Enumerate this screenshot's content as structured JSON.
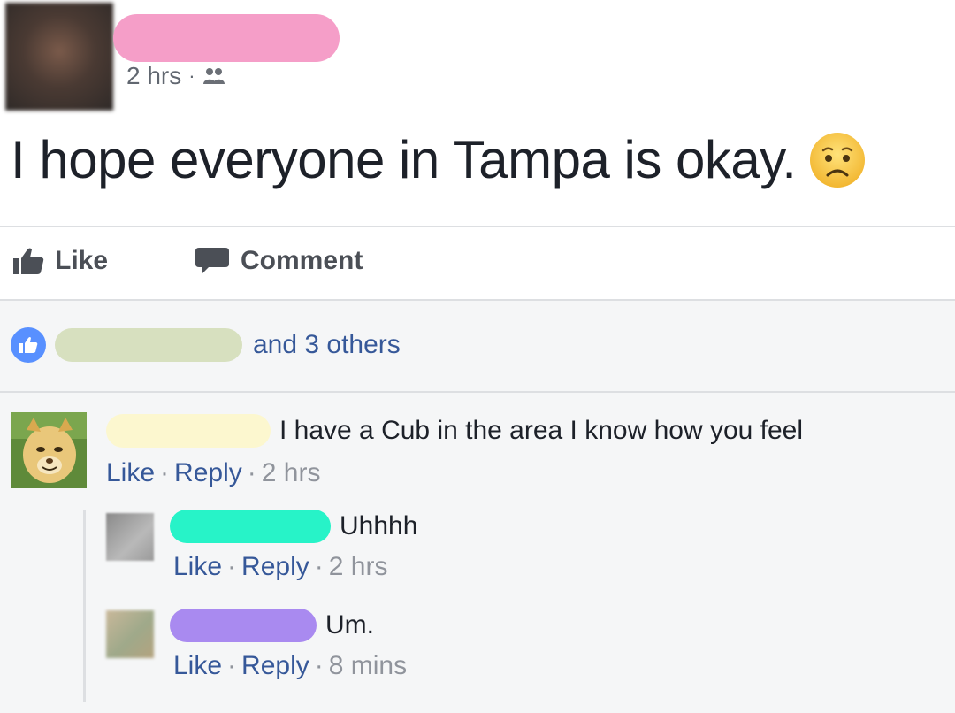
{
  "post": {
    "time": "2 hrs",
    "separator": "·",
    "text": "I hope everyone in Tampa is okay.",
    "emoji_icon": "worried-face-icon"
  },
  "actions": {
    "like_label": "Like",
    "comment_label": "Comment"
  },
  "likes": {
    "text": "and 3 others"
  },
  "comments": [
    {
      "text": "I have a Cub in the area I know how you feel",
      "like": "Like",
      "reply": "Reply",
      "time": "2 hrs"
    },
    {
      "text": "Uhhhh",
      "like": "Like",
      "reply": "Reply",
      "time": "2 hrs"
    },
    {
      "text": "Um.",
      "like": "Like",
      "reply": "Reply",
      "time": "8 mins"
    }
  ],
  "colors": {
    "link": "#365899",
    "like_badge": "#5890ff",
    "redact_author": "#f59ec8",
    "redact_likers": "#d7e0bf",
    "redact_c1": "#fcf7cf",
    "redact_c2": "#27f3c8",
    "redact_c3": "#a98af0"
  }
}
